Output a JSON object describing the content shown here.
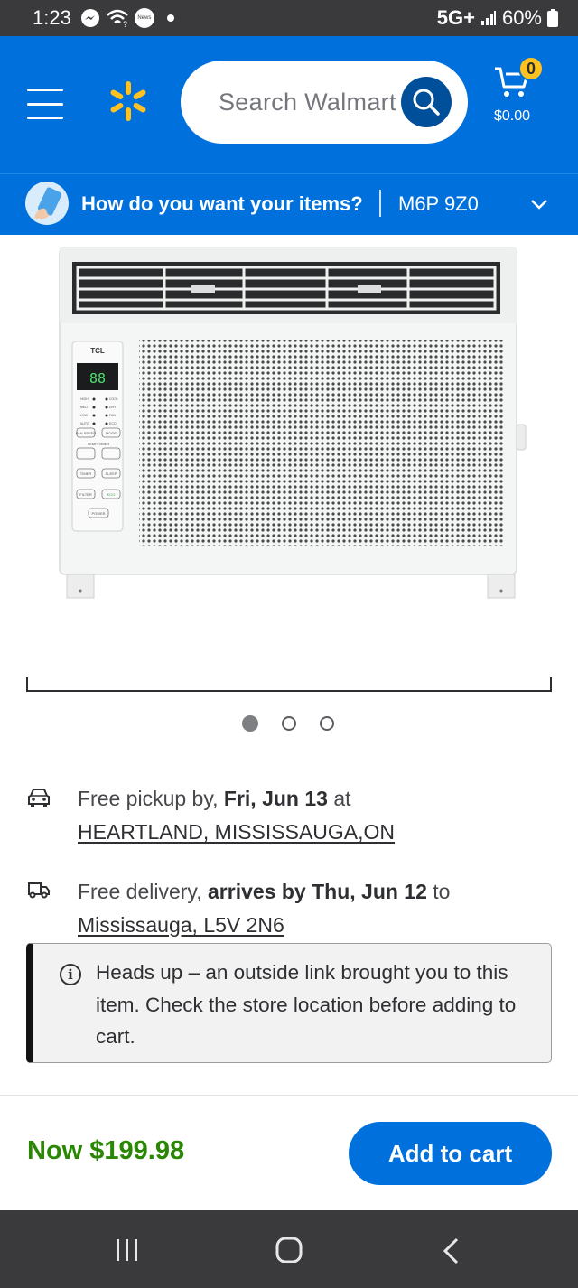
{
  "status_bar": {
    "time": "1:23",
    "network": "5G+",
    "battery": "60%",
    "news_label": "News"
  },
  "header": {
    "search_placeholder": "Search Walmart",
    "cart_count": "0",
    "cart_total": "$0.00",
    "brand_color": "#0071dc",
    "accent_color": "#ffc220"
  },
  "fulfillment_bar": {
    "question": "How do you want your items?",
    "postal_code": "M6P 9Z0"
  },
  "product_image": {
    "brand_label": "TCL",
    "display_value": "88",
    "carousel_total": 3,
    "carousel_active": 1,
    "panel_labels": [
      "HIGH",
      "MED",
      "LOW",
      "AUTO",
      "COOL",
      "DRY",
      "FAN",
      "ECO",
      "FAN SPEED",
      "MODE",
      "TEMP/TIMER",
      "TIMER",
      "SLEEP",
      "FILTER",
      "ECO",
      "POWER"
    ]
  },
  "pickup": {
    "prefix": "Free pickup by, ",
    "date": "Fri, Jun 13",
    "suffix": " at",
    "store": "HEARTLAND, MISSISSAUGA,ON"
  },
  "delivery": {
    "prefix": "Free delivery, ",
    "arrival": "arrives by Thu, Jun 12",
    "suffix": " to",
    "address": "Mississauga, L5V 2N6"
  },
  "alert": {
    "message": "Heads up – an outside link brought you to this item. Check the store location before adding to cart."
  },
  "footer": {
    "price_label": "Now $199.98",
    "add_to_cart": "Add to cart",
    "price_color": "#2a8703"
  }
}
